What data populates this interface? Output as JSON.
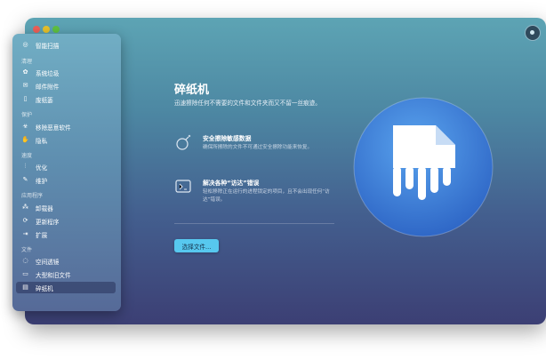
{
  "window": {
    "controls": [
      "close",
      "minimize",
      "zoom"
    ]
  },
  "sidebar": {
    "items": [
      {
        "label": "智能扫描",
        "icon": "smart-scan-icon"
      },
      {
        "label": "系统垃圾",
        "icon": "system-junk-icon"
      },
      {
        "label": "邮件附件",
        "icon": "mail-attachments-icon"
      },
      {
        "label": "废纸篓",
        "icon": "trash-bins-icon"
      },
      {
        "label": "移除恶意软件",
        "icon": "malware-removal-icon"
      },
      {
        "label": "隐私",
        "icon": "privacy-icon"
      },
      {
        "label": "优化",
        "icon": "optimization-icon"
      },
      {
        "label": "维护",
        "icon": "maintenance-icon"
      },
      {
        "label": "卸载器",
        "icon": "uninstaller-icon"
      },
      {
        "label": "更新程序",
        "icon": "updater-icon"
      },
      {
        "label": "扩展",
        "icon": "extensions-icon"
      },
      {
        "label": "空间透镜",
        "icon": "space-lens-icon"
      },
      {
        "label": "大型和旧文件",
        "icon": "large-old-files-icon"
      },
      {
        "label": "碎纸机",
        "icon": "shredder-icon"
      }
    ],
    "sections": {
      "cleanup": "清理",
      "protection": "保护",
      "speed": "速度",
      "applications": "应用程序",
      "files": "文件"
    },
    "active": "碎纸机"
  },
  "main": {
    "title": "碎纸机",
    "description": "迅速擦除任何不需要的文件和文件夹而又不留一丝痕迹。",
    "features": [
      {
        "title": "安全擦除敏感数据",
        "desc": "确保所擦除的文件不可通过安全擦除功能来恢复。",
        "icon": "bomb-icon"
      },
      {
        "title": "解决各种“访达”错误",
        "desc": "轻松移除正在运行的进程锁定的项目，且不会出现任何“访达”错误。",
        "icon": "finder-error-icon"
      }
    ],
    "choose_button": "选择文件..."
  },
  "colors": {
    "accent": "#57c8ef",
    "active_item": "#3a4880",
    "hero": "#3b7fd6"
  }
}
